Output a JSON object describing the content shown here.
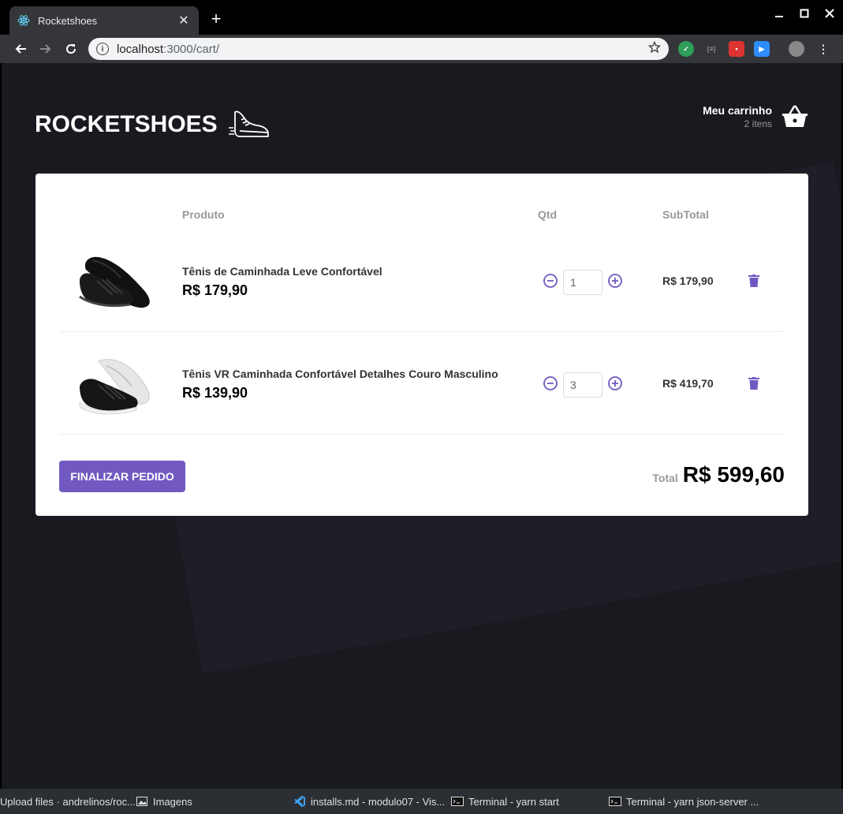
{
  "browser": {
    "tab_title": "Rocketshoes",
    "url_host": "localhost",
    "url_path": ":3000/cart/"
  },
  "header": {
    "logo": "ROCKETSHOES",
    "cart_title": "Meu carrinho",
    "cart_count": "2 itens"
  },
  "table": {
    "headers": {
      "product": "Produto",
      "qty": "Qtd",
      "subtotal": "SubTotal"
    },
    "items": [
      {
        "name": "Tênis de Caminhada Leve Confortável",
        "price": "R$ 179,90",
        "qty": "1",
        "subtotal": "R$ 179,90"
      },
      {
        "name": "Tênis VR Caminhada Confortável Detalhes Couro Masculino",
        "price": "R$ 139,90",
        "qty": "3",
        "subtotal": "R$ 419,70"
      }
    ]
  },
  "footer": {
    "checkout_label": "Finalizar pedido",
    "total_label": "Total",
    "total_value": "R$ 599,60"
  },
  "taskbar": {
    "items": [
      "Upload files · andrelinos/roc...",
      "Imagens",
      "installs.md - modulo07 - Vis...",
      "Terminal - yarn start",
      "Terminal - yarn json-server ..."
    ]
  },
  "colors": {
    "accent": "#7159c1",
    "page_bg": "#191920"
  }
}
